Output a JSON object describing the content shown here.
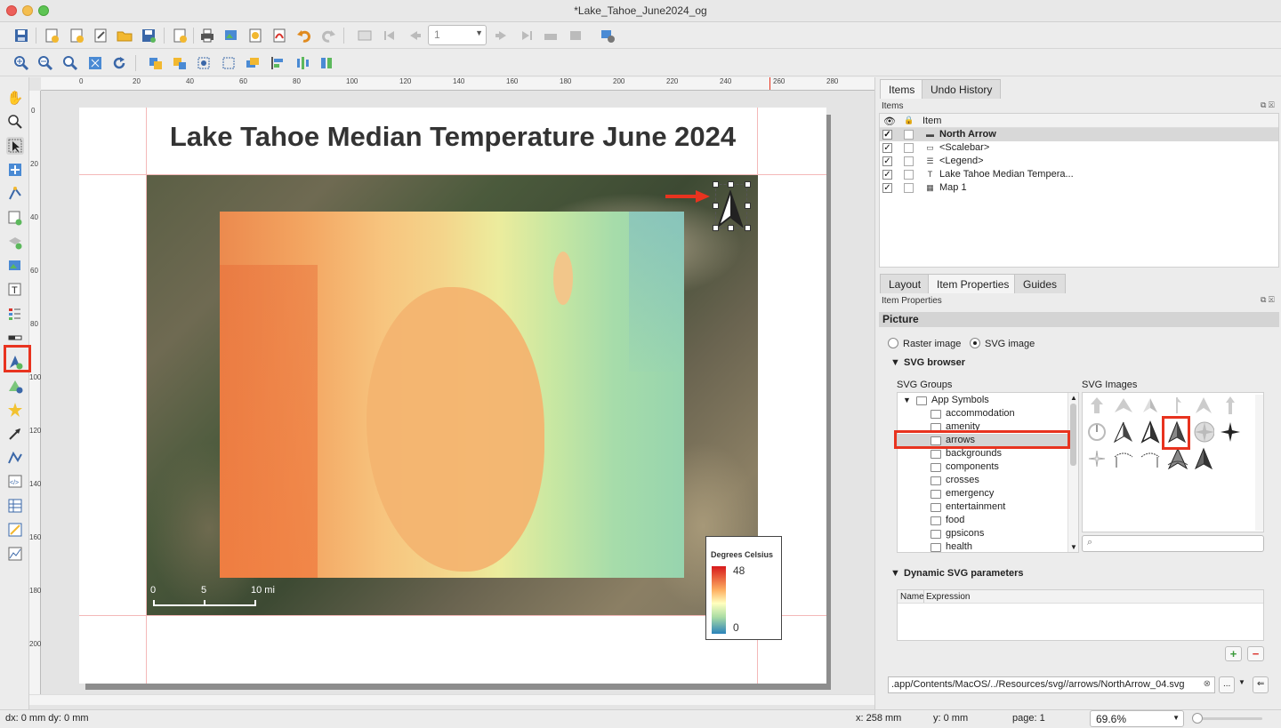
{
  "window": {
    "title": "*Lake_Tahoe_June2024_og"
  },
  "toolbar": {
    "page_number": "1",
    "icons": [
      "save-icon",
      "new-layout-icon",
      "duplicate-layout-icon",
      "layout-manager-icon",
      "open-template-icon",
      "save-template-icon",
      "new-report-icon",
      "print-icon",
      "export-image-icon",
      "export-svg-icon",
      "export-pdf-icon",
      "undo-icon",
      "redo-icon",
      "atlas-preview-icon",
      "first-feature-icon",
      "previous-feature-icon",
      "next-feature-icon",
      "last-feature-icon",
      "atlas-print-icon",
      "atlas-export-icon",
      "atlas-settings-icon"
    ]
  },
  "toolbar2": {
    "icons": [
      "zoom-in-icon",
      "zoom-out-icon",
      "zoom-100-icon",
      "zoom-full-icon",
      "refresh-icon",
      "group-icon",
      "ungroup-icon",
      "lock-items-icon",
      "unlock-items-icon",
      "raise-icon",
      "align-left-icon",
      "distribute-icon",
      "resize-icon"
    ]
  },
  "rulers": {
    "h_ticks": [
      "0",
      "20",
      "40",
      "60",
      "80",
      "100",
      "120",
      "140",
      "160",
      "180",
      "200",
      "220",
      "240",
      "260",
      "280"
    ],
    "v_ticks": [
      "0",
      "20",
      "40",
      "60",
      "80",
      "100",
      "120",
      "140",
      "160",
      "180",
      "200"
    ]
  },
  "map": {
    "title": "Lake Tahoe Median Temperature June 2024",
    "scalebar": {
      "labels": [
        "0",
        "5",
        "10 mi"
      ]
    },
    "legend": {
      "title": "Degrees Celsius",
      "max": "48",
      "min": "0"
    }
  },
  "items_panel": {
    "tabs": [
      "Items",
      "Undo History"
    ],
    "dock_title": "Items",
    "column_header": "Item",
    "items": [
      {
        "label": "North Arrow",
        "icon": "picture-icon",
        "visible": "✓"
      },
      {
        "label": "<Scalebar>",
        "icon": "scalebar-icon",
        "visible": "✓"
      },
      {
        "label": "<Legend>",
        "icon": "legend-icon",
        "visible": "✓"
      },
      {
        "label": "Lake Tahoe Median Tempera...",
        "icon": "label-icon",
        "visible": "✓"
      },
      {
        "label": "Map 1",
        "icon": "map-icon",
        "visible": "✓"
      }
    ]
  },
  "props_panel": {
    "tabs": [
      "Layout",
      "Item Properties",
      "Guides"
    ],
    "dock_title": "Item Properties",
    "section": "Picture",
    "raster_label": "Raster image",
    "svg_label": "SVG image",
    "svg_browser": "SVG browser",
    "svg_groups_label": "SVG Groups",
    "svg_images_label": "SVG Images",
    "groups_root": "App Symbols",
    "groups": [
      "accommodation",
      "amenity",
      "arrows",
      "backgrounds",
      "components",
      "crosses",
      "emergency",
      "entertainment",
      "food",
      "gpsicons",
      "health"
    ],
    "dynamic_params": "Dynamic SVG parameters",
    "col_name": "Name",
    "col_expression": "Expression",
    "path": ".app/Contents/MacOS/../Resources/svg//arrows/NorthArrow_04.svg",
    "browse": "...",
    "add_btn": "+",
    "remove_btn": "−"
  },
  "status": {
    "delta": "dx: 0 mm dy: 0 mm",
    "x": "x: 258 mm",
    "y": "y: 0 mm",
    "page": "page: 1",
    "zoom": "69.6%"
  },
  "colors": {
    "highlight": "#e8331f",
    "selection": "#d8d8d8"
  }
}
